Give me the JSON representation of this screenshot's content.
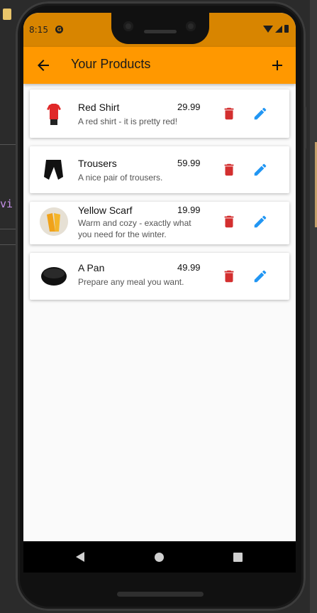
{
  "ide": {
    "code_fragment": "vi"
  },
  "status_bar": {
    "time": "8:15",
    "notification_icon": "g-icon"
  },
  "app_bar": {
    "title": "Your Products",
    "back_icon": "arrow-back-icon",
    "add_icon": "add-icon",
    "color": "#ff9800"
  },
  "products": [
    {
      "name": "Red Shirt",
      "price": "29.99",
      "description": "A red shirt - it is pretty red!",
      "image": "red-shirt"
    },
    {
      "name": "Trousers",
      "price": "59.99",
      "description": "A nice pair of trousers.",
      "image": "trousers"
    },
    {
      "name": "Yellow Scarf",
      "price": "19.99",
      "description": "Warm and cozy - exactly what you need for the winter.",
      "image": "yellow-scarf"
    },
    {
      "name": "A Pan",
      "price": "49.99",
      "description": "Prepare any meal you want.",
      "image": "pan"
    }
  ],
  "colors": {
    "delete": "#d32f2f",
    "edit": "#2196f3",
    "status_bar": "#d88500"
  }
}
